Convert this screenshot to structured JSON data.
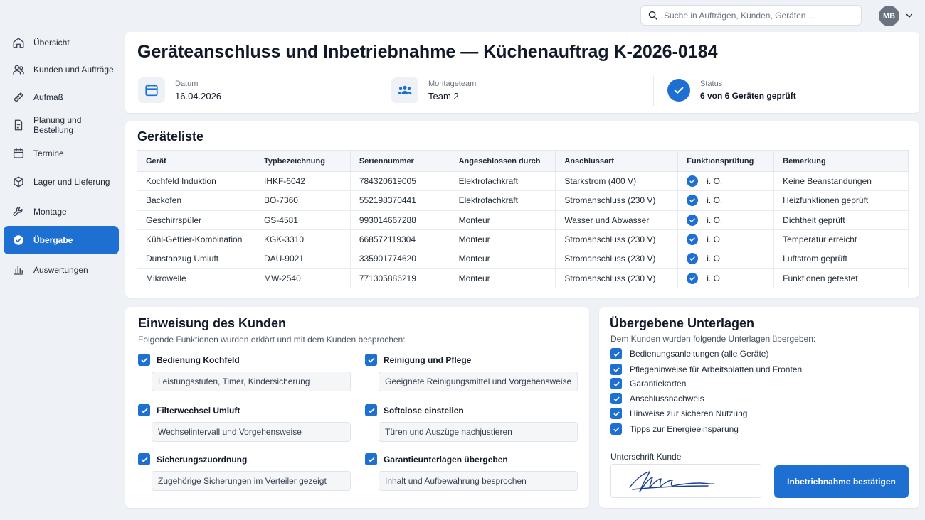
{
  "search": {
    "placeholder": "Suche in Aufträgen, Kunden, Geräten …"
  },
  "user": {
    "initials": "MB"
  },
  "sidebar": {
    "items": [
      {
        "label": "Übersicht",
        "icon": "home-icon"
      },
      {
        "label": "Kunden und Aufträge",
        "icon": "users-icon"
      },
      {
        "label": "Aufmaß",
        "icon": "ruler-icon"
      },
      {
        "label": "Planung und Bestellung",
        "icon": "document-icon"
      },
      {
        "label": "Termine",
        "icon": "calendar-icon"
      },
      {
        "label": "Lager und Lieferung",
        "icon": "box-icon"
      },
      {
        "label": "Montage",
        "icon": "wrench-icon"
      },
      {
        "label": "Übergabe",
        "icon": "check-circle-icon"
      },
      {
        "label": "Auswertungen",
        "icon": "bar-chart-icon"
      }
    ],
    "active_index": 7
  },
  "header": {
    "title": "Geräteanschluss und Inbetriebnahme — Küchenauftrag K-2026-0184",
    "date_label": "Datum",
    "date_value": "16.04.2026",
    "team_label": "Montageteam",
    "team_value": "Team 2",
    "status_label": "Status",
    "status_value": "6 von 6 Geräten geprüft"
  },
  "devices": {
    "title": "Geräteliste",
    "columns": [
      "Gerät",
      "Typbezeichnung",
      "Seriennummer",
      "Angeschlossen durch",
      "Anschlussart",
      "Funktionsprüfung",
      "Bemerkung"
    ],
    "rows": [
      [
        "Kochfeld Induktion",
        "IHKF-6042",
        "784320619005",
        "Elektrofachkraft",
        "Starkstrom (400 V)",
        "i. O.",
        "Keine Beanstandungen"
      ],
      [
        "Backofen",
        "BO-7360",
        "552198370441",
        "Elektrofachkraft",
        "Stromanschluss (230 V)",
        "i. O.",
        "Heizfunktionen geprüft"
      ],
      [
        "Geschirrspüler",
        "GS-4581",
        "993014667288",
        "Monteur",
        "Wasser und Abwasser",
        "i. O.",
        "Dichtheit geprüft"
      ],
      [
        "Kühl-Gefrier-Kombination",
        "KGK-3310",
        "668572119304",
        "Monteur",
        "Stromanschluss (230 V)",
        "i. O.",
        "Temperatur erreicht"
      ],
      [
        "Dunstabzug Umluft",
        "DAU-9021",
        "335901774620",
        "Monteur",
        "Stromanschluss (230 V)",
        "i. O.",
        "Luftstrom geprüft"
      ],
      [
        "Mikrowelle",
        "MW-2540",
        "771305886219",
        "Monteur",
        "Stromanschluss (230 V)",
        "i. O.",
        "Funktionen getestet"
      ]
    ]
  },
  "instruction": {
    "title": "Einweisung des Kunden",
    "subtitle": "Folgende Funktionen wurden erklärt und mit dem Kunden besprochen:",
    "items": [
      {
        "label": "Bedienung Kochfeld",
        "detail": "Leistungsstufen, Timer, Kindersicherung"
      },
      {
        "label": "Reinigung und Pflege",
        "detail": "Geeignete Reinigungsmittel und Vorgehensweise"
      },
      {
        "label": "Filterwechsel Umluft",
        "detail": "Wechselintervall und Vorgehensweise"
      },
      {
        "label": "Softclose einstellen",
        "detail": "Türen und Auszüge nachjustieren"
      },
      {
        "label": "Sicherungszuordnung",
        "detail": "Zugehörige Sicherungen im Verteiler gezeigt"
      },
      {
        "label": "Garantieunterlagen übergeben",
        "detail": "Inhalt und Aufbewahrung besprochen"
      }
    ]
  },
  "documents": {
    "title": "Übergebene Unterlagen",
    "subtitle": "Dem Kunden wurden folgende Unterlagen übergeben:",
    "items": [
      "Bedienungsanleitungen (alle Geräte)",
      "Pflegehinweise für Arbeitsplatten und Fronten",
      "Garantiekarten",
      "Anschlussnachweis",
      "Hinweise zur sicheren Nutzung",
      "Tipps zur Energieeinsparung"
    ],
    "signature_label": "Unterschrift Kunde",
    "confirm_label": "Inbetriebnahme bestätigen"
  },
  "colors": {
    "accent": "#1d6fd1",
    "background": "#eef1f5",
    "card": "#ffffff"
  }
}
